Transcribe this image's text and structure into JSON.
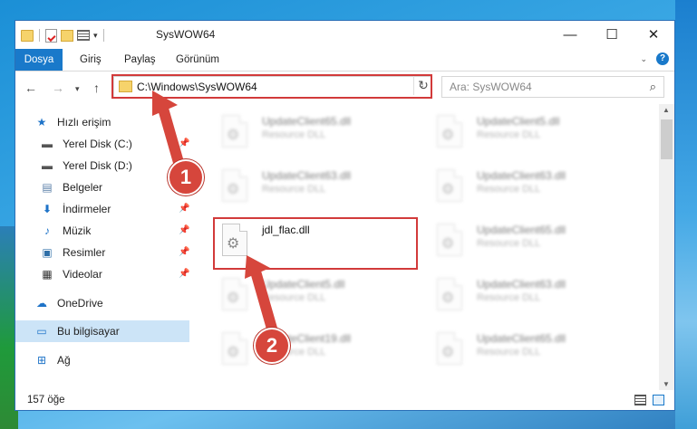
{
  "window": {
    "title": "SysWOW64",
    "controls": {
      "minimize": "—",
      "maximize": "☐",
      "close": "✕"
    }
  },
  "ribbon": {
    "tabs": [
      "Dosya",
      "Giriş",
      "Paylaş",
      "Görünüm"
    ],
    "help": "?"
  },
  "address": {
    "path": "C:\\Windows\\SysWOW64",
    "search_placeholder": "Ara: SysWOW64"
  },
  "sidebar": {
    "quick_access": "Hızlı erişim",
    "items": [
      {
        "label": "Yerel Disk (C:)"
      },
      {
        "label": "Yerel Disk (D:)"
      },
      {
        "label": "Belgeler"
      },
      {
        "label": "İndirmeler"
      },
      {
        "label": "Müzik"
      },
      {
        "label": "Resimler"
      },
      {
        "label": "Videolar"
      }
    ],
    "onedrive": "OneDrive",
    "this_pc": "Bu bilgisayar",
    "network": "Ağ"
  },
  "files": [
    {
      "name": "UpdateClient65.dll",
      "type": "Resource DLL"
    },
    {
      "name": "UpdateClient5.dll",
      "type": "Resource DLL"
    },
    {
      "name": "UpdateClient63.dll",
      "type": "Resource DLL"
    },
    {
      "name": "UpdateClient63.dll",
      "type": "Resource DLL"
    },
    {
      "name": "jdl_flac.dll",
      "type": ""
    },
    {
      "name": "UpdateClient65.dll",
      "type": "Resource DLL"
    },
    {
      "name": "UpdateClient5.dll",
      "type": "Resource DLL"
    },
    {
      "name": "UpdateClient63.dll",
      "type": "Resource DLL"
    },
    {
      "name": "UpdateClient19.dll",
      "type": "Resource DLL"
    },
    {
      "name": "UpdateClient65.dll",
      "type": "Resource DLL"
    }
  ],
  "status": {
    "item_count": "157 öğe"
  },
  "annotations": {
    "step1": "1",
    "step2": "2",
    "highlight_color": "#d23a3a"
  }
}
